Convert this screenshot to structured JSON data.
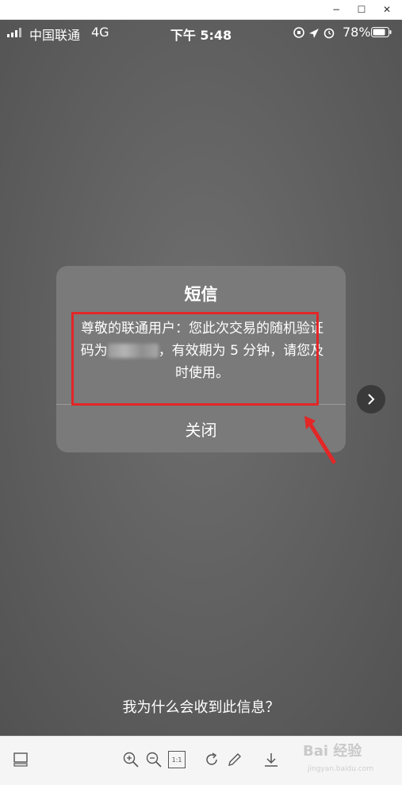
{
  "window": {
    "minimize_glyph": "−",
    "maximize_glyph": "☐",
    "close_glyph": "✕"
  },
  "status_bar": {
    "carrier": "中国联通",
    "network": "4G",
    "time": "下午 5:48",
    "battery": "78%"
  },
  "dialog": {
    "title": "短信",
    "body_part1": "尊敬的联通用户：您此次交易的随机验证码为",
    "body_part2": "，有效期为 5 分钟，请您及时使用。",
    "close_label": "关闭"
  },
  "footer_link": "我为什么会收到此信息？",
  "toolbar": {
    "actual_size_label": "1:1"
  },
  "watermark": {
    "brand": "Bai 经验",
    "url": "jingyan.baidu.com"
  },
  "colors": {
    "annotation": "#e32626",
    "dialog_bg": "#7a7a7a",
    "overlay_bg": "#5f5f5f"
  }
}
